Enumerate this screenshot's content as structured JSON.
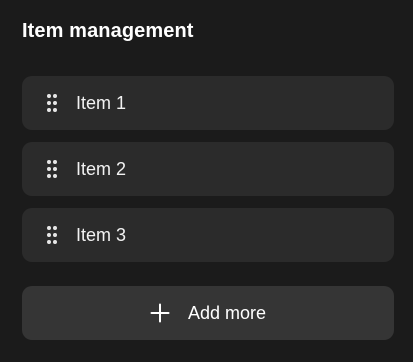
{
  "header": {
    "title": "Item management"
  },
  "items": [
    {
      "label": "Item 1",
      "icon": "drag-handle-icon"
    },
    {
      "label": "Item 2",
      "icon": "drag-handle-icon"
    },
    {
      "label": "Item 3",
      "icon": "drag-handle-icon"
    }
  ],
  "add_button": {
    "label": "Add more",
    "icon": "plus-icon"
  },
  "colors": {
    "background": "#1b1b1b",
    "item_background": "#2b2b2b",
    "button_background": "#353535",
    "text": "#ffffff"
  }
}
